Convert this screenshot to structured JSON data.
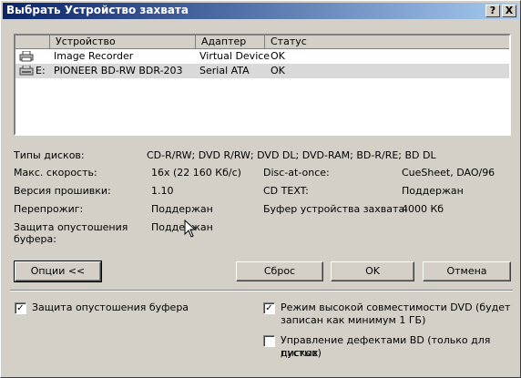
{
  "window": {
    "title": "Выбрать Устройство захвата"
  },
  "titlebar_buttons": {
    "help": "?",
    "close": "X"
  },
  "device_list": {
    "columns": [
      "Устройство",
      "Адаптер",
      "Статус"
    ],
    "rows": [
      {
        "drive": "",
        "device": "Image Recorder",
        "adapter": "Virtual Device",
        "status": "OK",
        "selected": false
      },
      {
        "drive": "E:",
        "device": "PIONEER  BD-RW   BDR-203",
        "adapter": "Serial ATA",
        "status": "OK",
        "selected": true
      }
    ]
  },
  "info": {
    "disc_types_label": "Типы дисков:",
    "disc_types_value": "CD-R/RW; DVD R/RW; DVD DL; DVD-RAM; BD-R/RE; BD DL",
    "max_speed_label": "Макс. скорость:",
    "max_speed_value": "16x (22 160 Кб/с)",
    "firmware_label": "Версия прошивки:",
    "firmware_value": "1.10",
    "overburn_label": "Перепрожиг:",
    "overburn_value": "Поддержан",
    "underrun_label": "Защита опустошения буфера:",
    "underrun_value": "Поддержан",
    "dao_label": "Disc-at-once:",
    "dao_value": "CueSheet, DAO/96",
    "cdtext_label": "CD TEXT:",
    "cdtext_value": "Поддержан",
    "buffer_label": "Буфер устройства захвата:",
    "buffer_value": "4000 Кб"
  },
  "buttons": {
    "options": "Опции <<",
    "reset": "Сброс",
    "ok": "OK",
    "cancel": "Отмена"
  },
  "options": {
    "buffer_protect": {
      "label": "Защита опустошения буфера",
      "checked": true
    },
    "dvd_compat": {
      "label_line1": "Режим высокой совместимости DVD (будет",
      "label_line2": "записан как минимум 1 ГБ)",
      "checked": true
    },
    "bd_defect": {
      "label_line1": "Управление дефектами BD (только для пустых",
      "label_line2": "дисков)",
      "checked": false
    }
  }
}
